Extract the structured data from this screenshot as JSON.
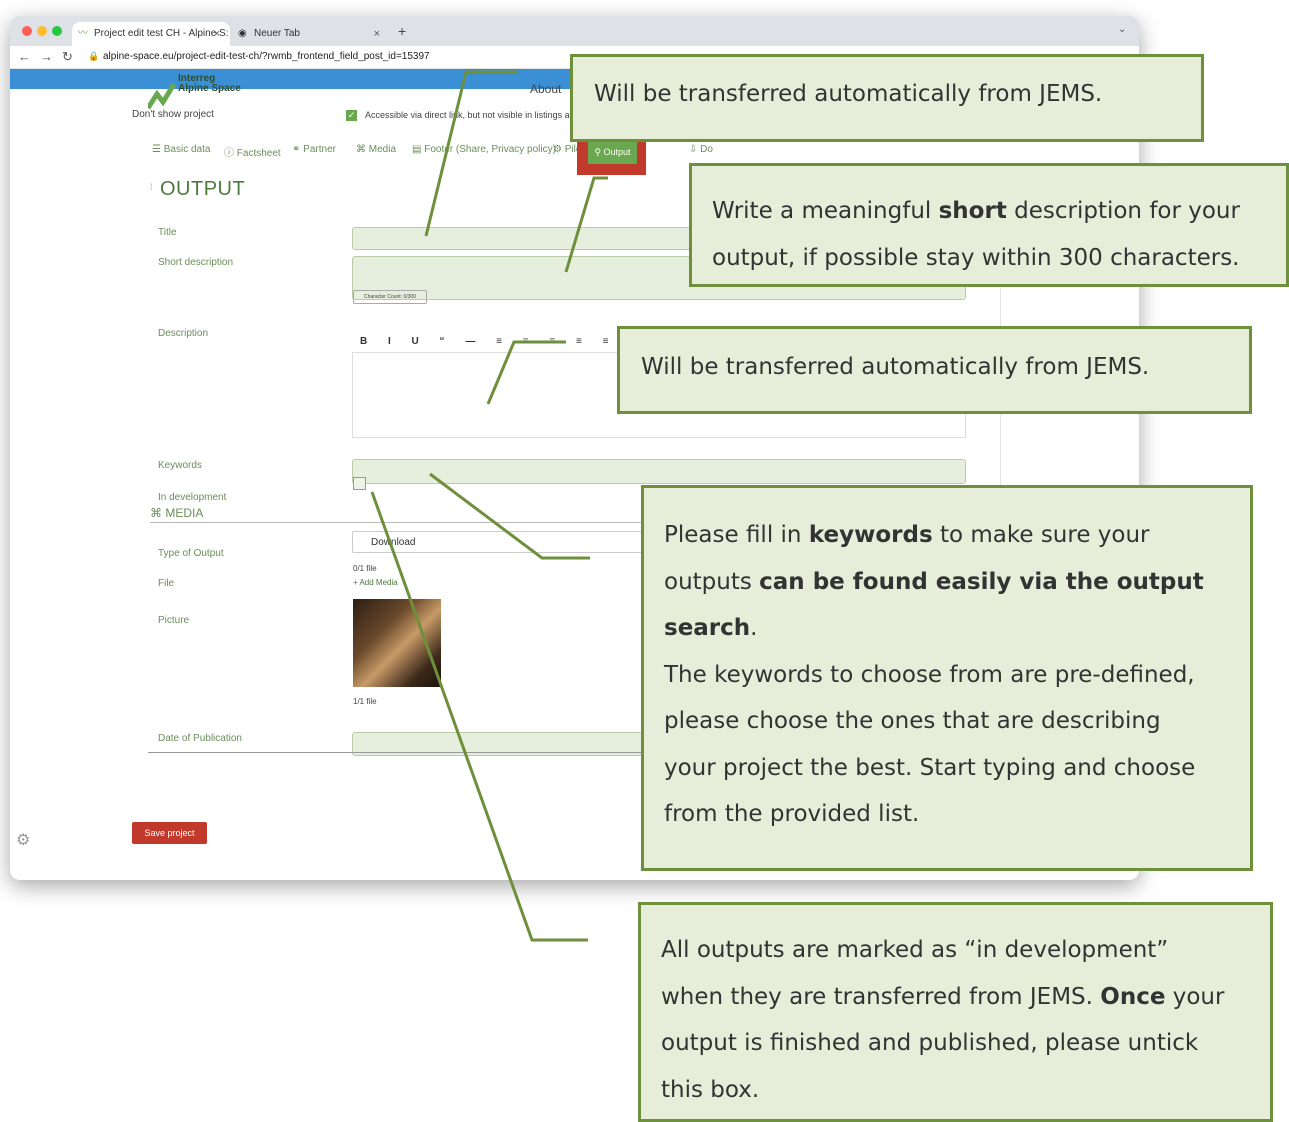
{
  "browser": {
    "tabs": [
      {
        "label": "Project edit test CH - Alpine S:"
      },
      {
        "label": "Neuer Tab"
      }
    ],
    "new_tab": "+",
    "url": "alpine-space.eu/project-edit-test-ch/?rwmb_frontend_field_post_id=15397"
  },
  "site": {
    "logo_line1": "Interreg",
    "logo_line2": "Alpine Space",
    "nav_about": "About",
    "dont_show_label": "Don't show project",
    "access_text": "Accessible via direct link, but not visible in listings a",
    "tabs": [
      "Basic data",
      "Factsheet",
      "Partner",
      "Media",
      "Footer (Share, Privacy policy)",
      "Pilot",
      "Output",
      "Do"
    ],
    "section_title": "OUTPUT",
    "fields": {
      "title": "Title",
      "short_description": "Short description",
      "char_count": "Character Count: 0/300",
      "description": "Description",
      "keywords": "Keywords",
      "in_development": "In development",
      "media_header": "MEDIA",
      "type_of_output": "Type of Output",
      "type_value": "Download",
      "file": "File",
      "file_count": "0/1 file",
      "add_media": "+ Add Media",
      "picture": "Picture",
      "picture_count": "1/1 file",
      "date_of_publication": "Date of Publication"
    },
    "toolbar": "B I U “ — ≡ ≡ ≡ ≡ ≡ ↶ ↷ 🔗",
    "save_button": "Save project"
  },
  "callouts": {
    "c1": "Will be transferred automatically from JEMS.",
    "c2": {
      "l1a": "Write a meaningful ",
      "l1b": "short",
      "l1c": " description for your",
      "l2": "output, if possible stay within 300 characters."
    },
    "c3": "Will be transferred automatically from JEMS.",
    "c4": {
      "l1a": "Please fill in ",
      "l1b": "keywords",
      "l1c": " to make sure your",
      "l2a": "outputs ",
      "l2b": "can be found easily via the output",
      "l3a": "search",
      "l3b": ".",
      "l4": "The keywords to choose from are pre-defined,",
      "l5": "please choose the ones that are describing",
      "l6": "your project the best. Start typing and choose",
      "l7": "from the provided list."
    },
    "c5": {
      "l1": "All outputs are marked as “in development”",
      "l2a": "when they are transferred from JEMS. ",
      "l2b": "Once",
      "l2c": " your",
      "l3": "output is finished and published, please untick",
      "l4": "this box."
    }
  },
  "colors": {
    "callout_bg": "#e6eed9",
    "callout_border": "#6e8f3b",
    "accent_green": "#6aa84f",
    "highlight_red": "#c0392b"
  }
}
